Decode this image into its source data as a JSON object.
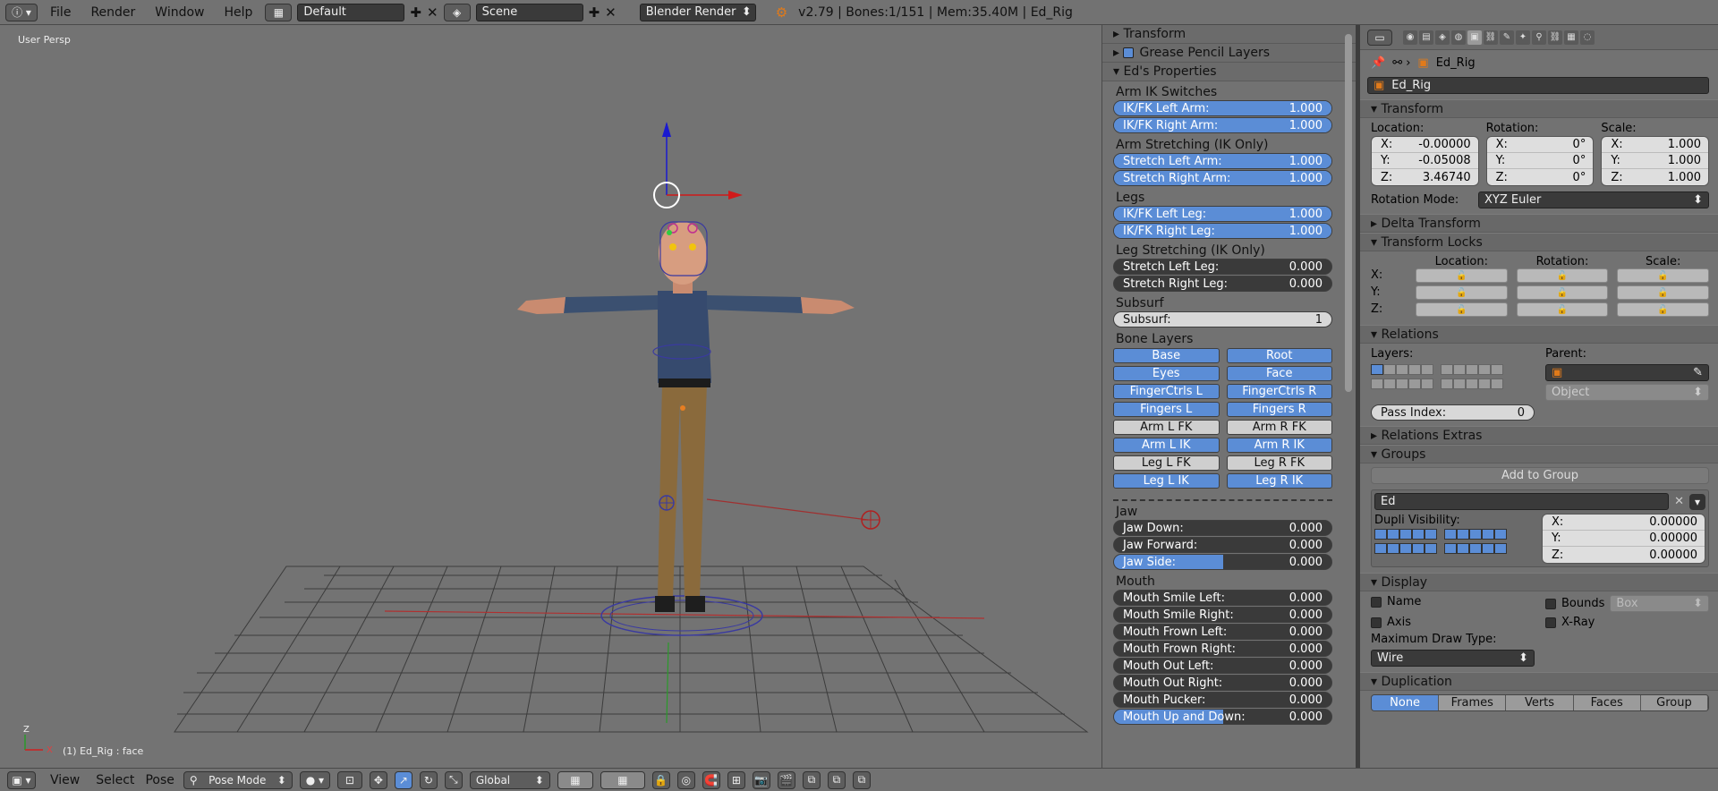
{
  "topbar": {
    "menus": [
      "File",
      "Render",
      "Window",
      "Help"
    ],
    "screen_layout": "Default",
    "scene": "Scene",
    "render_engine": "Blender Render",
    "info": "v2.79 | Bones:1/151  | Mem:35.40M | Ed_Rig"
  },
  "viewport": {
    "view_label": "User Persp",
    "object_label": "(1) Ed_Rig : face"
  },
  "npanel": {
    "collapsed_panels": [
      "Transform",
      "Grease Pencil Layers"
    ],
    "open_panel": "Ed's Properties",
    "groups": [
      {
        "label": "Arm IK Switches",
        "sliders": [
          {
            "label": "IK/FK Left Arm:",
            "value": "1.000",
            "fill": 1.0
          },
          {
            "label": "IK/FK Right Arm:",
            "value": "1.000",
            "fill": 1.0
          }
        ]
      },
      {
        "label": "Arm Stretching (IK Only)",
        "sliders": [
          {
            "label": "Stretch Left Arm:",
            "value": "1.000",
            "fill": 1.0
          },
          {
            "label": "Stretch Right Arm:",
            "value": "1.000",
            "fill": 1.0
          }
        ]
      },
      {
        "label": "Legs",
        "sliders": [
          {
            "label": "IK/FK Left Leg:",
            "value": "1.000",
            "fill": 1.0
          },
          {
            "label": "IK/FK Right Leg:",
            "value": "1.000",
            "fill": 1.0
          }
        ]
      },
      {
        "label": "Leg Stretching (IK Only)",
        "sliders": [
          {
            "label": "Stretch Left Leg:",
            "value": "0.000",
            "fill": 0.0
          },
          {
            "label": "Stretch Right Leg:",
            "value": "0.000",
            "fill": 0.0
          }
        ]
      }
    ],
    "subsurf_label": "Subsurf",
    "subsurf_field": {
      "label": "Subsurf:",
      "value": "1"
    },
    "bone_layers_label": "Bone Layers",
    "bone_layers": [
      {
        "label": "Base",
        "on": true
      },
      {
        "label": "Root",
        "on": true
      },
      {
        "label": "Eyes",
        "on": true
      },
      {
        "label": "Face",
        "on": true
      },
      {
        "label": "FingerCtrls L",
        "on": true
      },
      {
        "label": "FingerCtrls R",
        "on": true
      },
      {
        "label": "Fingers L",
        "on": true
      },
      {
        "label": "Fingers R",
        "on": true
      },
      {
        "label": "Arm L FK",
        "on": false
      },
      {
        "label": "Arm R FK",
        "on": false
      },
      {
        "label": "Arm L IK",
        "on": true
      },
      {
        "label": "Arm R IK",
        "on": true
      },
      {
        "label": "Leg L FK",
        "on": false
      },
      {
        "label": "Leg R FK",
        "on": false
      },
      {
        "label": "Leg L IK",
        "on": true
      },
      {
        "label": "Leg R IK",
        "on": true
      }
    ],
    "jaw_label": "Jaw",
    "jaw_sliders": [
      {
        "label": "Jaw Down:",
        "value": "0.000",
        "fill": 0.0
      },
      {
        "label": "Jaw Forward:",
        "value": "0.000",
        "fill": 0.0
      },
      {
        "label": "Jaw Side:",
        "value": "0.000",
        "fill": 0.5
      }
    ],
    "mouth_label": "Mouth",
    "mouth_sliders": [
      {
        "label": "Mouth Smile Left:",
        "value": "0.000",
        "fill": 0.0
      },
      {
        "label": "Mouth Smile Right:",
        "value": "0.000",
        "fill": 0.0
      },
      {
        "label": "Mouth Frown Left:",
        "value": "0.000",
        "fill": 0.0
      },
      {
        "label": "Mouth Frown Right:",
        "value": "0.000",
        "fill": 0.0
      },
      {
        "label": "Mouth Out Left:",
        "value": "0.000",
        "fill": 0.0
      },
      {
        "label": "Mouth Out Right:",
        "value": "0.000",
        "fill": 0.0
      },
      {
        "label": "Mouth Pucker:",
        "value": "0.000",
        "fill": 0.0
      },
      {
        "label": "Mouth Up and Down:",
        "value": "0.000",
        "fill": 0.5
      }
    ]
  },
  "properties": {
    "breadcrumb_object": "Ed_Rig",
    "object_name": "Ed_Rig",
    "transform": {
      "title": "Transform",
      "location_label": "Location:",
      "rotation_label": "Rotation:",
      "scale_label": "Scale:",
      "location": [
        {
          "axis": "X:",
          "value": "-0.00000"
        },
        {
          "axis": "Y:",
          "value": "-0.05008"
        },
        {
          "axis": "Z:",
          "value": "3.46740"
        }
      ],
      "rotation": [
        {
          "axis": "X:",
          "value": "0°"
        },
        {
          "axis": "Y:",
          "value": "0°"
        },
        {
          "axis": "Z:",
          "value": "0°"
        }
      ],
      "scale": [
        {
          "axis": "X:",
          "value": "1.000"
        },
        {
          "axis": "Y:",
          "value": "1.000"
        },
        {
          "axis": "Z:",
          "value": "1.000"
        }
      ],
      "rotation_mode_label": "Rotation Mode:",
      "rotation_mode": "XYZ Euler"
    },
    "delta_transform": "Delta Transform",
    "transform_locks": {
      "title": "Transform Locks",
      "col_labels": [
        "Location:",
        "Rotation:",
        "Scale:"
      ],
      "row_labels": [
        "X:",
        "Y:",
        "Z:"
      ]
    },
    "relations": {
      "title": "Relations",
      "layers_label": "Layers:",
      "parent_label": "Parent:",
      "parent_type": "Object",
      "pass_index_label": "Pass Index:",
      "pass_index": "0"
    },
    "relations_extras": "Relations Extras",
    "groups": {
      "title": "Groups",
      "add_button": "Add to Group",
      "group_name": "Ed",
      "dupli_label": "Dupli Visibility:",
      "offset": [
        {
          "axis": "X:",
          "value": "0.00000"
        },
        {
          "axis": "Y:",
          "value": "0.00000"
        },
        {
          "axis": "Z:",
          "value": "0.00000"
        }
      ]
    },
    "display": {
      "title": "Display",
      "name_label": "Name",
      "axis_label": "Axis",
      "bounds_label": "Bounds",
      "bounds_type": "Box",
      "xray_label": "X-Ray",
      "max_draw_label": "Maximum Draw Type:",
      "max_draw": "Wire"
    },
    "duplication": {
      "title": "Duplication",
      "options": [
        {
          "label": "None",
          "on": true
        },
        {
          "label": "Frames",
          "on": false
        },
        {
          "label": "Verts",
          "on": false
        },
        {
          "label": "Faces",
          "on": false
        },
        {
          "label": "Group",
          "on": false
        }
      ]
    }
  },
  "bottombar": {
    "menus": [
      "View",
      "Select",
      "Pose"
    ],
    "mode": "Pose Mode",
    "orientation": "Global"
  }
}
